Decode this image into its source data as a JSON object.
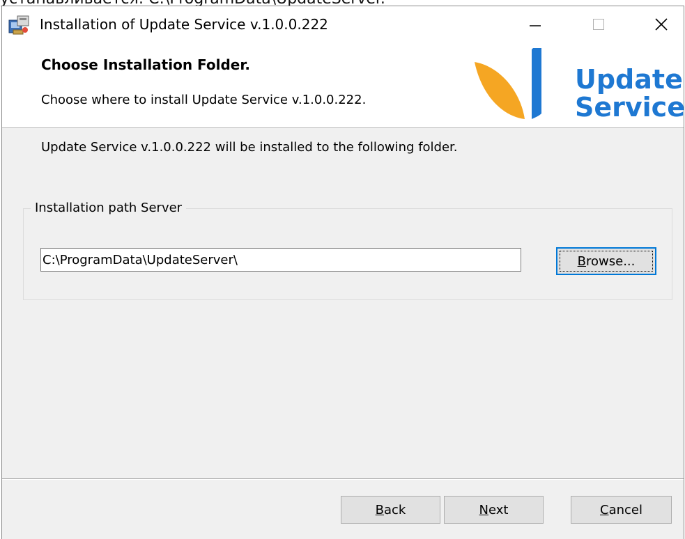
{
  "background_caption": "устанавливается: C:\\ProgramData\\UpdateServer.",
  "window": {
    "title": "Installation of Update Service v.1.0.0.222",
    "controls": {
      "minimize": "—",
      "maximize": "☐",
      "close": "✕"
    }
  },
  "header": {
    "title": "Choose Installation Folder.",
    "subtitle": "Choose where to install Update Service v.1.0.0.222.",
    "logo": {
      "line1": "Update",
      "line2": "Service",
      "brand_blue": "#1e78d2",
      "brand_orange": "#f5a623"
    }
  },
  "body": {
    "intro": "Update Service v.1.0.0.222 will be installed to the following folder.",
    "group_label": "Installation path Server",
    "path_value": "C:\\ProgramData\\UpdateServer\\",
    "browse": {
      "mnemonic": "B",
      "rest": "rowse..."
    }
  },
  "footer": {
    "back": {
      "mnemonic": "B",
      "rest": "ack"
    },
    "next": {
      "mnemonic": "N",
      "rest": "ext"
    },
    "cancel": {
      "mnemonic": "C",
      "rest": "ancel"
    }
  },
  "icons": [
    "installer-icon",
    "minimize-icon",
    "maximize-icon",
    "close-icon",
    "update-service-logo"
  ]
}
